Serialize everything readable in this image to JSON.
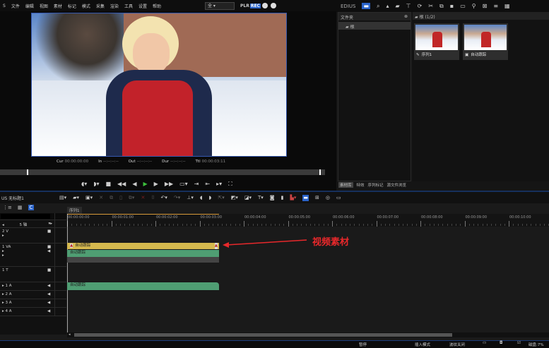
{
  "menu": {
    "app_fragment": "S",
    "items": [
      "文件",
      "编辑",
      "视图",
      "素材",
      "标记",
      "模式",
      "采集",
      "渲染",
      "工具",
      "设置",
      "帮助"
    ],
    "dropdown_value": "全",
    "plr": "PLR",
    "rec": "REC"
  },
  "player": {
    "timecodes": [
      {
        "label": "Cur",
        "value": "00:00:00:00"
      },
      {
        "label": "In",
        "value": "--:--:--:--"
      },
      {
        "label": "Out",
        "value": "--:--:--:--"
      },
      {
        "label": "Dur",
        "value": "--:--:--:--"
      },
      {
        "label": "Ttl",
        "value": "00:00:03:11"
      }
    ]
  },
  "bin": {
    "logo": "EDIUS",
    "folder_header": "文件夹",
    "root_folder": "根",
    "clip_header": "根 (1/2)",
    "clips": [
      "序列1",
      "自动跟踪"
    ],
    "tabs": [
      "素材库",
      "特效",
      "序列标记",
      "源文件浏览"
    ]
  },
  "timeline": {
    "project": "US 无标题1",
    "sequence_tab": "序列1",
    "track_mode": "5 轴",
    "ruler": [
      "00:00:00:00",
      "00:00:01:00",
      "00:00:02:00",
      "00:00:03:00",
      "00:00:04:00",
      "00:00:05:00",
      "00:00:06:00",
      "00:00:07:00",
      "00:00:08:00",
      "00:00:09:00",
      "00:00:10:00"
    ],
    "tracks": [
      "2 V",
      "1 VA",
      "1 T",
      "1 A",
      "2 A",
      "3 A",
      "4 A"
    ],
    "clip_name": "自动跟踪",
    "annotation": "视频素材"
  },
  "status": {
    "state": "暂停",
    "insert": "插入模式",
    "ripple": "波纹关闭",
    "disk": "磁盘:7%"
  },
  "colors": {
    "video_clip": "#d6b94e",
    "audio_clip": "#4f9e73",
    "accent": "#2a63c9",
    "annotation": "#e8282b"
  }
}
